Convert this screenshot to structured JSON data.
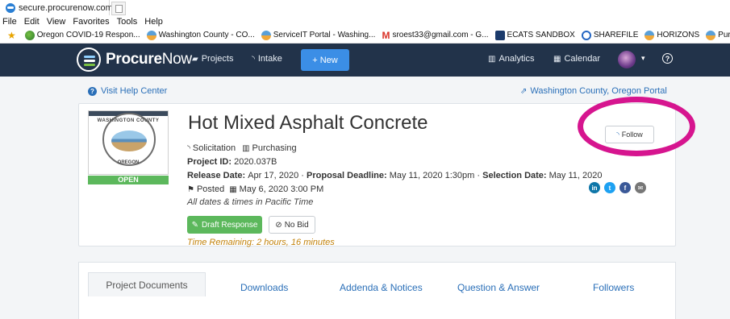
{
  "browser": {
    "tab_title": "secure.procurenow.com",
    "tab_close": "×",
    "menu": [
      "File",
      "Edit",
      "View",
      "Favorites",
      "Tools",
      "Help"
    ],
    "favorites": [
      "Oregon COVID-19 Respon...",
      "Washington County - CO...",
      "ServiceIT Portal - Washing...",
      "sroest33@gmail.com - G...",
      "ECATS SANDBOX",
      "SHAREFILE",
      "HORIZONS",
      "Purchasing"
    ]
  },
  "nav": {
    "logo_bold": "Procure",
    "logo_light": "Now",
    "projects": "Projects",
    "intake": "Intake",
    "new": "+ New",
    "analytics": "Analytics",
    "calendar": "Calendar",
    "caret": "▾",
    "help": "?"
  },
  "page": {
    "help_center": "Visit Help Center",
    "portal_link": "Washington County, Oregon Portal"
  },
  "project": {
    "seal_top": "WASHINGTON COUNTY",
    "seal_bottom": "OREGON",
    "status": "OPEN",
    "title": "Hot Mixed Asphalt Concrete",
    "type": "Solicitation",
    "department": "Purchasing",
    "project_id_label": "Project ID:",
    "project_id": "2020.037B",
    "release_label": "Release Date:",
    "release_date": "Apr 17, 2020",
    "deadline_label": "Proposal Deadline:",
    "deadline": "May 11, 2020 1:30pm",
    "selection_label": "Selection Date:",
    "selection_date": "May 11, 2020",
    "separator": "·",
    "posted_label": "Posted",
    "posted_date": "May 6, 2020 3:00 PM",
    "timezone_note": "All dates & times in Pacific Time",
    "draft_button": "Draft Response",
    "nobid_button": "No Bid",
    "time_remaining": "Time Remaining: 2 hours, 16 minutes",
    "follow_button": "Follow"
  },
  "social": [
    {
      "icon": "in",
      "color": "#0e76a8"
    },
    {
      "icon": "t",
      "color": "#1da1f2"
    },
    {
      "icon": "f",
      "color": "#3b5998"
    },
    {
      "icon": "✉",
      "color": "#777777"
    }
  ],
  "tabs": [
    "Project Documents",
    "Downloads",
    "Addenda & Notices",
    "Question & Answer",
    "Followers"
  ],
  "colors": {
    "nav_bg": "#22334a",
    "accent": "#3b8ee6",
    "open": "#5cb85c",
    "annotation": "#d6158f"
  }
}
